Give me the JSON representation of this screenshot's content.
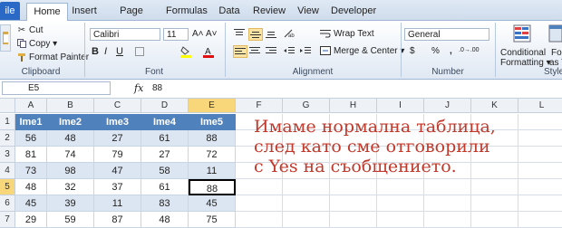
{
  "tabs": [
    "ile",
    "Home",
    "Insert",
    "Page Layout",
    "Formulas",
    "Data",
    "Review",
    "View",
    "Developer"
  ],
  "active_tab": "Home",
  "clipboard": {
    "cut": "Cut",
    "copy": "Copy ▾",
    "format_painter": "Format Painter",
    "group": "Clipboard"
  },
  "font": {
    "name": "Calibri",
    "size": "11",
    "grow": "A˄",
    "shrink": "A˅",
    "group": "Font",
    "bold": "B",
    "italic": "I",
    "underline": "U"
  },
  "alignment": {
    "wrap": "Wrap Text",
    "merge": "Merge & Center ▾",
    "group": "Alignment"
  },
  "number": {
    "format": "General",
    "currency": "$",
    "percent": "%",
    "comma": ",",
    "inc_dec": ".0→.00",
    "dec_dec": ".00→.0",
    "group": "Number"
  },
  "styles": {
    "conditional_1": "Conditional",
    "conditional_2": "Formatting ▾",
    "format_as_1": "Fo",
    "format_as_2": "as T",
    "group": "Style"
  },
  "formula_bar": {
    "name_box": "E5",
    "fx": "fx",
    "value": "88"
  },
  "columns": [
    "A",
    "B",
    "C",
    "D",
    "E",
    "F",
    "G",
    "H",
    "I",
    "J",
    "K",
    "L"
  ],
  "rows": [
    "1",
    "2",
    "3",
    "4",
    "5",
    "6",
    "7"
  ],
  "table": {
    "headers": [
      "Ime1",
      "Ime2",
      "Ime3",
      "Ime4",
      "Ime5"
    ],
    "rows": [
      [
        "56",
        "48",
        "27",
        "61",
        "88"
      ],
      [
        "81",
        "74",
        "79",
        "27",
        "72"
      ],
      [
        "73",
        "98",
        "47",
        "58",
        "11"
      ],
      [
        "48",
        "32",
        "37",
        "61",
        "88"
      ],
      [
        "45",
        "39",
        "11",
        "83",
        "45"
      ],
      [
        "29",
        "59",
        "87",
        "48",
        "75"
      ]
    ]
  },
  "annotation": [
    "Имаме нормална таблица,",
    "след като сме отговорили",
    "с  Yes на съобщението."
  ],
  "colors": {
    "header_fill": "#4f81bd",
    "band_fill": "#dce6f2",
    "annotation": "#c0392b",
    "selected_header": "#f8d67a"
  }
}
